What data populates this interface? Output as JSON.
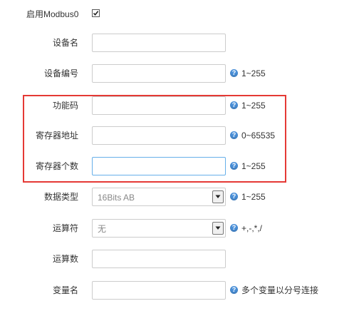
{
  "enable_modbus": {
    "label": "启用Modbus0",
    "checked": true
  },
  "device_name": {
    "label": "设备名",
    "value": ""
  },
  "device_number": {
    "label": "设备编号",
    "value": "",
    "hint": "1~255"
  },
  "function_code": {
    "label": "功能码",
    "value": "",
    "hint": "1~255"
  },
  "register_address": {
    "label": "寄存器地址",
    "value": "",
    "hint": "0~65535"
  },
  "register_count": {
    "label": "寄存器个数",
    "value": "",
    "hint": "1~255"
  },
  "data_type": {
    "label": "数据类型",
    "selected": "16Bits AB",
    "hint": "1~255"
  },
  "operator": {
    "label": "运算符",
    "selected": "无",
    "hint": "+,-,*,/"
  },
  "operand": {
    "label": "运算数",
    "value": ""
  },
  "variable_name": {
    "label": "变量名",
    "value": "",
    "hint": "多个变量以分号连接"
  },
  "help_icon_glyph": "?",
  "colors": {
    "highlight": "#e53935",
    "help_icon": "#4a90d9",
    "focus_border": "#66afe9"
  }
}
